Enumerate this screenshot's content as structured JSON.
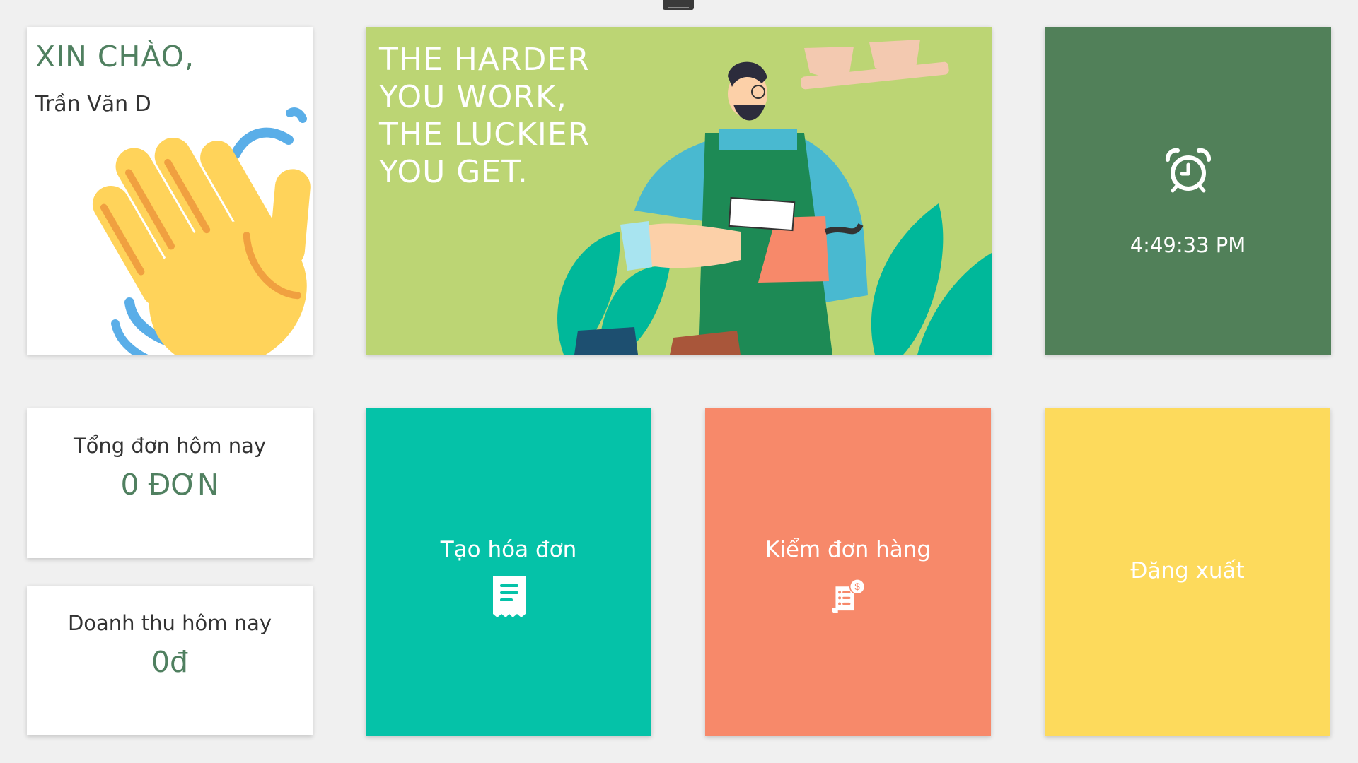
{
  "greeting": {
    "title": "XIN CHÀO,",
    "name": "Trần Văn D",
    "icon": "waving-hand-icon"
  },
  "banner": {
    "quote_lines": [
      "THE HARDER",
      "YOU WORK,",
      "THE LUCKIER",
      "YOU GET."
    ],
    "illustration": "barista-illustration"
  },
  "clock": {
    "icon": "alarm-clock-icon",
    "time": "4:49:33 PM"
  },
  "stats": {
    "orders_label": "Tổng đơn hôm nay",
    "orders_value": "0 ĐƠN",
    "revenue_label": "Doanh thu hôm nay",
    "revenue_value": "0đ"
  },
  "actions": {
    "create_invoice": {
      "label": "Tạo hóa đơn",
      "icon": "receipt-icon"
    },
    "check_orders": {
      "label": "Kiểm đơn hàng",
      "icon": "bill-check-icon"
    },
    "logout": {
      "label": "Đăng xuất"
    }
  },
  "colors": {
    "background": "#f0f0f0",
    "accent_green": "#508060",
    "banner_green": "#bcd574",
    "clock_green": "#518059",
    "teal": "#05c2a8",
    "coral": "#f7896a",
    "yellow": "#fdda5c"
  }
}
